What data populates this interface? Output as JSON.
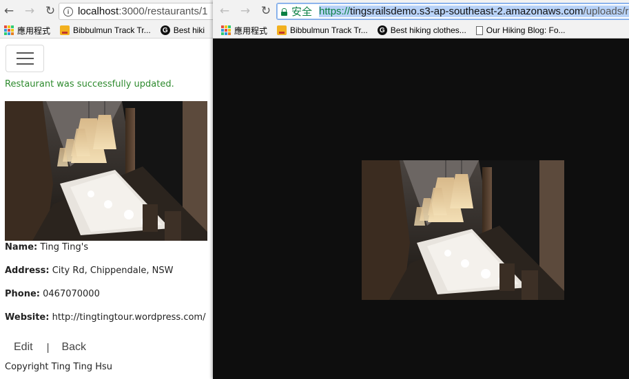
{
  "left_window": {
    "nav": {
      "back": "←",
      "forward": "→",
      "reload": "↻",
      "info": "i"
    },
    "address": {
      "host": "localhost",
      "path": ":3000/restaurants/1"
    },
    "bookmarks": [
      {
        "icon": "apps-grid-icon",
        "label": "應用程式"
      },
      {
        "icon": "bookmark-badge-icon",
        "label": "Bibbulmun Track Tr..."
      },
      {
        "icon": "g-logo-icon",
        "label": "Best hiki"
      }
    ],
    "flash": "Restaurant was successfully updated.",
    "details": {
      "name_label": "Name:",
      "name_value": "Ting Ting's",
      "address_label": "Address:",
      "address_value": "City Rd, Chippendale, NSW",
      "phone_label": "Phone:",
      "phone_value": "0467070000",
      "website_label": "Website:",
      "website_value": "http://tingtingtour.wordpress.com/"
    },
    "links": {
      "edit": "Edit",
      "separator": "|",
      "back": "Back"
    },
    "footer": "Copyright Ting Ting Hsu"
  },
  "right_window": {
    "nav": {
      "back": "←",
      "forward": "→",
      "reload": "↻"
    },
    "address": {
      "secure_label": "安全",
      "scheme": "https://",
      "host": "tingsrailsdemo.s3-ap-southeast-2.amazonaws.com",
      "path": "/uploads/re"
    },
    "bookmarks": [
      {
        "icon": "apps-grid-icon",
        "label": "應用程式"
      },
      {
        "icon": "bookmark-badge-icon",
        "label": "Bibbulmun Track Tr..."
      },
      {
        "icon": "g-logo-icon",
        "label": "Best hiking clothes..."
      },
      {
        "icon": "document-icon",
        "label": "Our Hiking Blog: Fo..."
      }
    ]
  },
  "colors": {
    "flash_green": "#2d8a2d",
    "secure_green": "#0b8043",
    "image_viewer_bg": "#0e0e0e"
  }
}
